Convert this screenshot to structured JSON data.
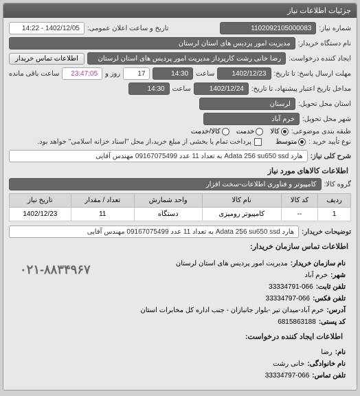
{
  "header": {
    "title": "جزئیات اطلاعات نیاز"
  },
  "form": {
    "request_number_label": "شماره نیاز:",
    "request_number": "1102092105000083",
    "public_date_label": "تاریخ و ساعت اعلان عمومی:",
    "public_date": "1402/12/05 - 14:22",
    "buyer_org_label": "نام دستگاه خریدار:",
    "buyer_org": "مدیریت امور پردیس های استان لرستان",
    "creator_label": "ایجاد کننده درخواست:",
    "creator": "رضا خانی رشت کارپرداز  مدیریت امور پردیس های استان لرستان",
    "contact_btn": "اطلاعات تماس خریدار",
    "reply_deadline_label": "مهلت ارسال پاسخ: تا تاریخ:",
    "reply_date": "1402/12/23",
    "reply_time_label": "ساعت",
    "reply_time": "14:30",
    "days": "17",
    "days_label": "روز و",
    "remaining_time": "23:47:05",
    "remaining_label": "ساعت باقی مانده",
    "validity_label": "مداخل تاریخ اعتبار پیشنهاد، تا تاریخ:",
    "validity_date": "1402/12/24",
    "validity_time_label": "ساعت",
    "validity_time": "14:30",
    "province_label": "استان محل تحویل:",
    "province": "لرستان",
    "city_label": "شهر محل تحویل:",
    "city": "خرم آباد",
    "item_type_label": "طبقه بندی موضوعی:",
    "radio_goods": "کالا",
    "radio_service": "خدمت",
    "radio_goods_service": "کالا/خدمت",
    "purchase_type_label": "نوع تأیید خرید :",
    "radio_medium": "متوسط",
    "payment_note": "پرداخت تمام یا بخشی از مبلغ خرید،از محل \"اسناد خزانه اسلامی\" خواهد بود.",
    "description_label": "شرح کلی نیاز:",
    "description": "هارد Adata 256 su650 ssd به تعداد 11 عدد 09167075499 مهندس آقایی"
  },
  "goods": {
    "section_title": "اطلاعات کالاهای مورد نیاز",
    "group_label": "گروه کالا:",
    "group_value": "کامپیوتر و فناوری اطلاعات-سخت افزار",
    "headers": {
      "row": "ردیف",
      "code": "کد کالا",
      "name": "نام کالا",
      "unit": "واحد شمارش",
      "qty": "تعداد / مقدار",
      "date": "تاریخ نیاز"
    },
    "rows": [
      {
        "row": "1",
        "code": "--",
        "name": "کامپیوتر رومیزی",
        "unit": "دستگاه",
        "qty": "11",
        "date": "1402/12/23"
      }
    ],
    "buyer_notes_label": "توضیحات خریدار:",
    "buyer_notes": "هارد Adata 256 su650 ssd به تعداد 11 عدد 09167075499 مهندس آقایی"
  },
  "contact": {
    "section_title": "اطلاعات تماس سازمان خریدار:",
    "org_name_label": "نام سازمان خریدار:",
    "org_name": "مدیریت امور پردیس های استان لرستان",
    "city_label": "شهر:",
    "city": "خرم آباد",
    "phone_label": "تلفن ثابت:",
    "phone": "33334791-066",
    "fax_label": "تلفن فکس:",
    "fax": "33334797-066",
    "address_label": "آدرس:",
    "address": "خرم آباد-میدان تیر -بلوار جانبازان - جنب اداره کل مخابرات استان",
    "postal_label": "کد پستی:",
    "postal": "6815863188",
    "creator_section": "اطلاعات ایجاد کننده درخواست:",
    "name_label": "نام:",
    "name": "رضا",
    "family_label": "نام خانوادگی:",
    "family": "خانی رشت",
    "contact_phone_label": "تلفن تماس:",
    "contact_phone": "33334797-066",
    "big_phone": "۰۲۱-۸۸۳۴۹۶۷"
  }
}
